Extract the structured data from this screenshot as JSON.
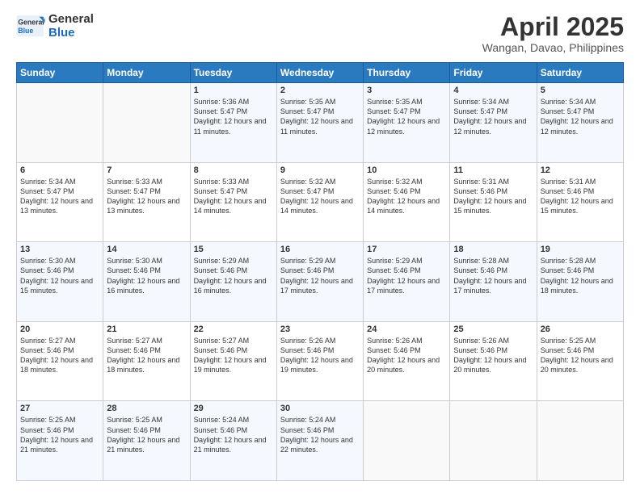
{
  "header": {
    "logo_line1": "General",
    "logo_line2": "Blue",
    "month_title": "April 2025",
    "location": "Wangan, Davao, Philippines"
  },
  "weekdays": [
    "Sunday",
    "Monday",
    "Tuesday",
    "Wednesday",
    "Thursday",
    "Friday",
    "Saturday"
  ],
  "weeks": [
    [
      {
        "day": "",
        "info": ""
      },
      {
        "day": "",
        "info": ""
      },
      {
        "day": "1",
        "info": "Sunrise: 5:36 AM\nSunset: 5:47 PM\nDaylight: 12 hours and 11 minutes."
      },
      {
        "day": "2",
        "info": "Sunrise: 5:35 AM\nSunset: 5:47 PM\nDaylight: 12 hours and 11 minutes."
      },
      {
        "day": "3",
        "info": "Sunrise: 5:35 AM\nSunset: 5:47 PM\nDaylight: 12 hours and 12 minutes."
      },
      {
        "day": "4",
        "info": "Sunrise: 5:34 AM\nSunset: 5:47 PM\nDaylight: 12 hours and 12 minutes."
      },
      {
        "day": "5",
        "info": "Sunrise: 5:34 AM\nSunset: 5:47 PM\nDaylight: 12 hours and 12 minutes."
      }
    ],
    [
      {
        "day": "6",
        "info": "Sunrise: 5:34 AM\nSunset: 5:47 PM\nDaylight: 12 hours and 13 minutes."
      },
      {
        "day": "7",
        "info": "Sunrise: 5:33 AM\nSunset: 5:47 PM\nDaylight: 12 hours and 13 minutes."
      },
      {
        "day": "8",
        "info": "Sunrise: 5:33 AM\nSunset: 5:47 PM\nDaylight: 12 hours and 14 minutes."
      },
      {
        "day": "9",
        "info": "Sunrise: 5:32 AM\nSunset: 5:47 PM\nDaylight: 12 hours and 14 minutes."
      },
      {
        "day": "10",
        "info": "Sunrise: 5:32 AM\nSunset: 5:46 PM\nDaylight: 12 hours and 14 minutes."
      },
      {
        "day": "11",
        "info": "Sunrise: 5:31 AM\nSunset: 5:46 PM\nDaylight: 12 hours and 15 minutes."
      },
      {
        "day": "12",
        "info": "Sunrise: 5:31 AM\nSunset: 5:46 PM\nDaylight: 12 hours and 15 minutes."
      }
    ],
    [
      {
        "day": "13",
        "info": "Sunrise: 5:30 AM\nSunset: 5:46 PM\nDaylight: 12 hours and 15 minutes."
      },
      {
        "day": "14",
        "info": "Sunrise: 5:30 AM\nSunset: 5:46 PM\nDaylight: 12 hours and 16 minutes."
      },
      {
        "day": "15",
        "info": "Sunrise: 5:29 AM\nSunset: 5:46 PM\nDaylight: 12 hours and 16 minutes."
      },
      {
        "day": "16",
        "info": "Sunrise: 5:29 AM\nSunset: 5:46 PM\nDaylight: 12 hours and 17 minutes."
      },
      {
        "day": "17",
        "info": "Sunrise: 5:29 AM\nSunset: 5:46 PM\nDaylight: 12 hours and 17 minutes."
      },
      {
        "day": "18",
        "info": "Sunrise: 5:28 AM\nSunset: 5:46 PM\nDaylight: 12 hours and 17 minutes."
      },
      {
        "day": "19",
        "info": "Sunrise: 5:28 AM\nSunset: 5:46 PM\nDaylight: 12 hours and 18 minutes."
      }
    ],
    [
      {
        "day": "20",
        "info": "Sunrise: 5:27 AM\nSunset: 5:46 PM\nDaylight: 12 hours and 18 minutes."
      },
      {
        "day": "21",
        "info": "Sunrise: 5:27 AM\nSunset: 5:46 PM\nDaylight: 12 hours and 18 minutes."
      },
      {
        "day": "22",
        "info": "Sunrise: 5:27 AM\nSunset: 5:46 PM\nDaylight: 12 hours and 19 minutes."
      },
      {
        "day": "23",
        "info": "Sunrise: 5:26 AM\nSunset: 5:46 PM\nDaylight: 12 hours and 19 minutes."
      },
      {
        "day": "24",
        "info": "Sunrise: 5:26 AM\nSunset: 5:46 PM\nDaylight: 12 hours and 20 minutes."
      },
      {
        "day": "25",
        "info": "Sunrise: 5:26 AM\nSunset: 5:46 PM\nDaylight: 12 hours and 20 minutes."
      },
      {
        "day": "26",
        "info": "Sunrise: 5:25 AM\nSunset: 5:46 PM\nDaylight: 12 hours and 20 minutes."
      }
    ],
    [
      {
        "day": "27",
        "info": "Sunrise: 5:25 AM\nSunset: 5:46 PM\nDaylight: 12 hours and 21 minutes."
      },
      {
        "day": "28",
        "info": "Sunrise: 5:25 AM\nSunset: 5:46 PM\nDaylight: 12 hours and 21 minutes."
      },
      {
        "day": "29",
        "info": "Sunrise: 5:24 AM\nSunset: 5:46 PM\nDaylight: 12 hours and 21 minutes."
      },
      {
        "day": "30",
        "info": "Sunrise: 5:24 AM\nSunset: 5:46 PM\nDaylight: 12 hours and 22 minutes."
      },
      {
        "day": "",
        "info": ""
      },
      {
        "day": "",
        "info": ""
      },
      {
        "day": "",
        "info": ""
      }
    ]
  ]
}
